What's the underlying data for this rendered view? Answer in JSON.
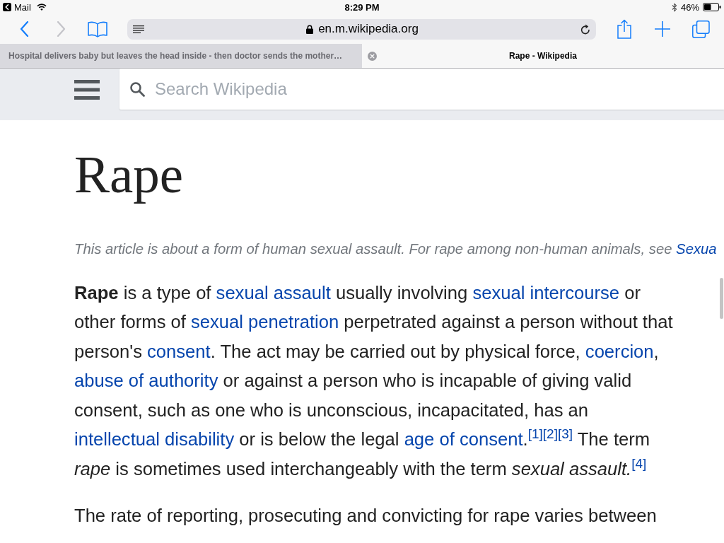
{
  "status_bar": {
    "back_app": "Mail",
    "time": "8:29 PM",
    "battery": "46%"
  },
  "toolbar": {
    "nav_buttons": [
      {
        "kind": "back",
        "disabled": false
      },
      {
        "kind": "forward",
        "disabled": true
      }
    ],
    "address": "en.m.wikipedia.org"
  },
  "tabs": [
    {
      "title": "Hospital delivers baby but leaves the head inside - then doctor sends the mother…",
      "selected": false
    },
    {
      "title": "Rape - Wikipedia",
      "selected": true
    }
  ],
  "wiki_header": {
    "search": {
      "placeholder": "Search Wikipedia"
    }
  },
  "article": {
    "title": "Rape",
    "hatnote": [
      {
        "kind": "text",
        "text": "This article is about a form of human sexual assault. For rape among non-human animals, see "
      },
      {
        "kind": "link",
        "text": "Sexua"
      }
    ],
    "paragraphs": [
      {
        "segments": [
          {
            "kind": "bold",
            "text": "Rape"
          },
          {
            "kind": "text",
            "text": " is a type of "
          },
          {
            "kind": "link",
            "text": "sexual assault"
          },
          {
            "kind": "text",
            "text": " usually involving "
          },
          {
            "kind": "link",
            "text": "sexual intercourse"
          },
          {
            "kind": "text",
            "text": " or other forms of "
          },
          {
            "kind": "link",
            "text": "sexual penetration"
          },
          {
            "kind": "text",
            "text": " perpetrated against a person without that person's "
          },
          {
            "kind": "link",
            "text": "consent"
          },
          {
            "kind": "text",
            "text": ". The act may be carried out by physical force, "
          },
          {
            "kind": "link",
            "text": "coercion"
          },
          {
            "kind": "text",
            "text": ", "
          },
          {
            "kind": "link",
            "text": "abuse of authority"
          },
          {
            "kind": "text",
            "text": " or against a person who is incapable of giving valid consent, such as one who is unconscious, incapacitated, has an "
          },
          {
            "kind": "link",
            "text": "intellectual disability"
          },
          {
            "kind": "text",
            "text": " or is below the legal "
          },
          {
            "kind": "link",
            "text": "age of consent"
          },
          {
            "kind": "text",
            "text": "."
          },
          {
            "kind": "ref",
            "text": "[1]"
          },
          {
            "kind": "ref",
            "text": "[2]"
          },
          {
            "kind": "ref",
            "text": "[3]"
          },
          {
            "kind": "text",
            "text": " The term "
          },
          {
            "kind": "italic",
            "text": "rape"
          },
          {
            "kind": "text",
            "text": " is sometimes used interchangeably with the term "
          },
          {
            "kind": "italic",
            "text": "sexual assault."
          },
          {
            "kind": "ref",
            "text": "[4]"
          }
        ]
      },
      {
        "segments": [
          {
            "kind": "text",
            "text": "The rate of reporting, prosecuting and convicting for rape varies between"
          }
        ]
      }
    ]
  }
}
